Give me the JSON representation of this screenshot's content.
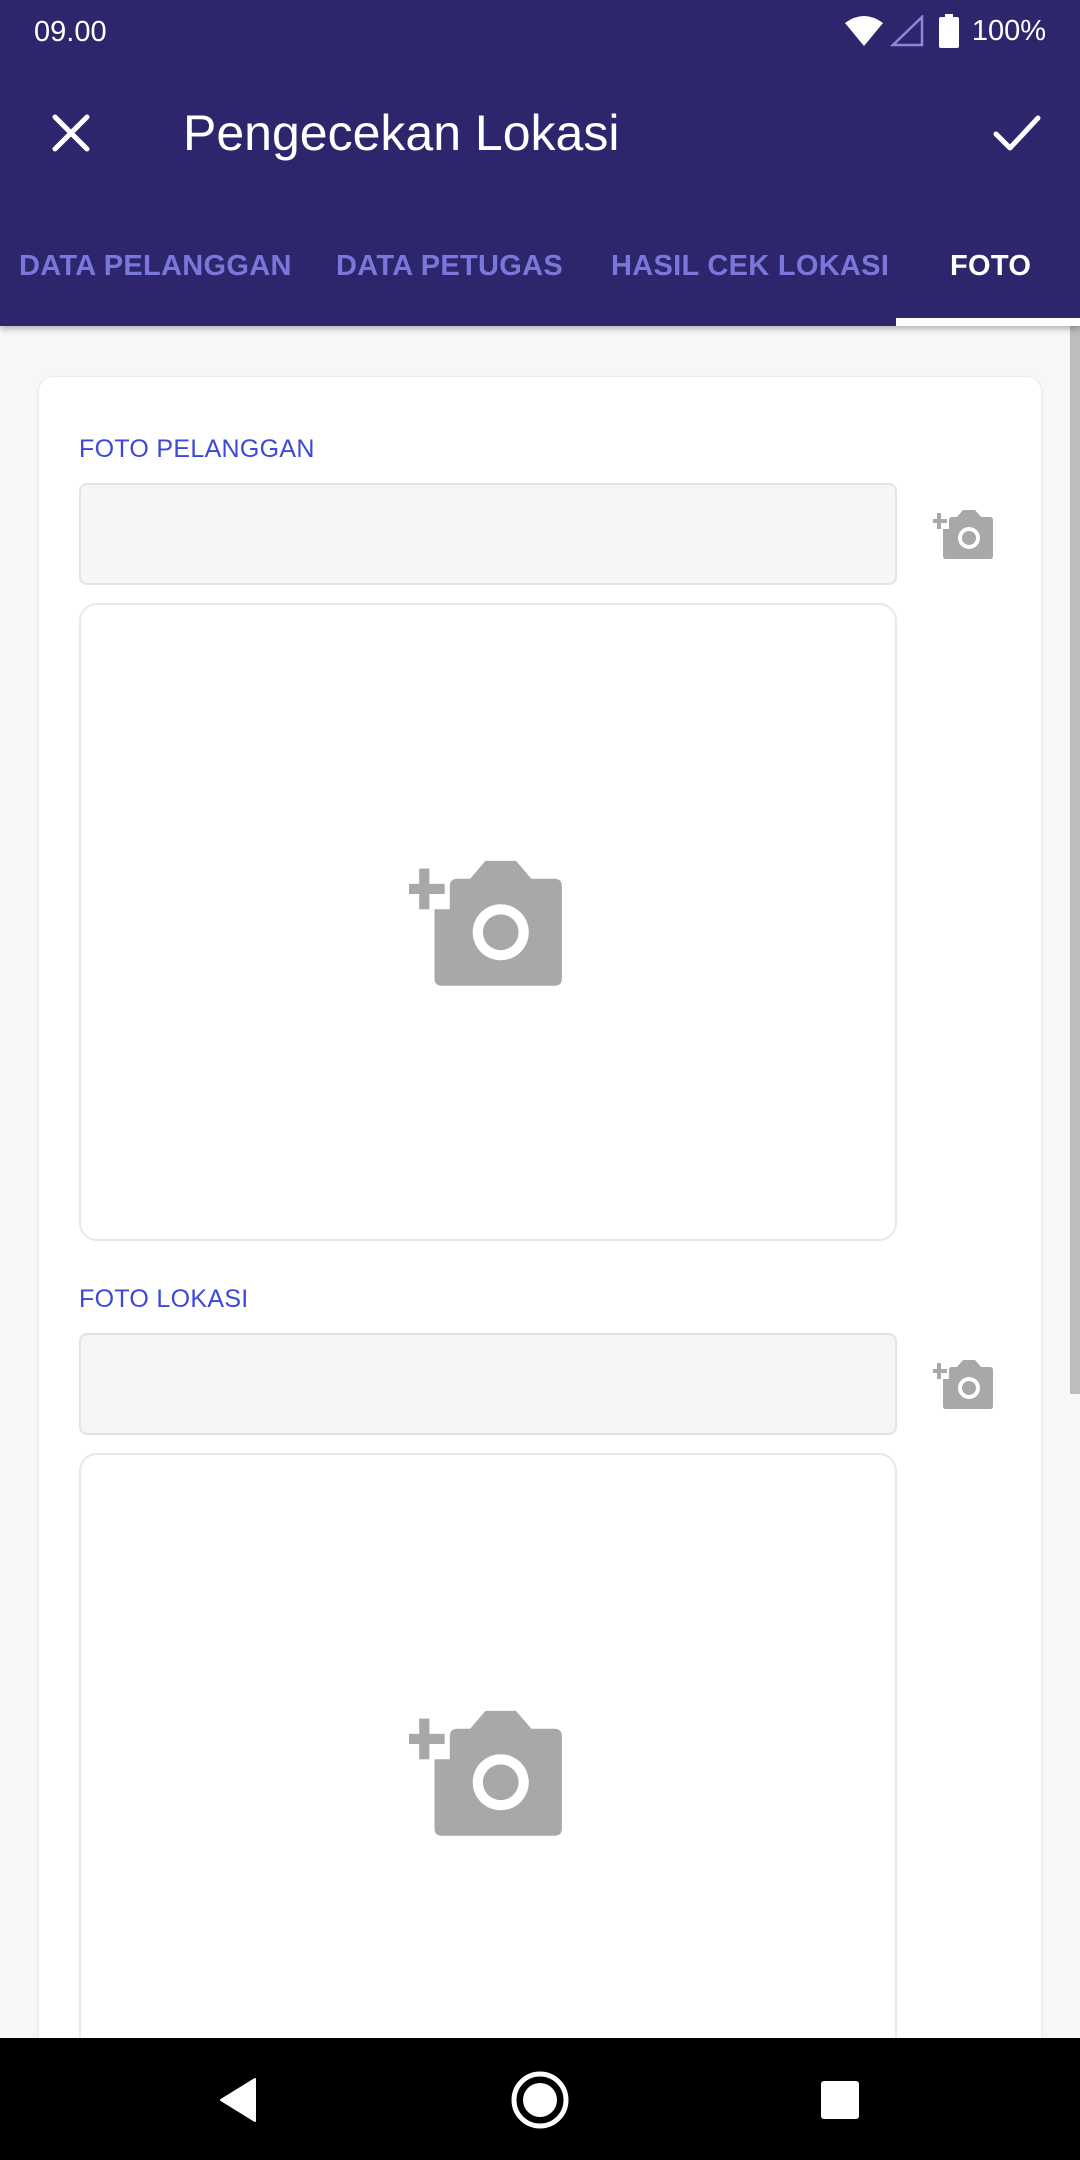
{
  "status_bar": {
    "time": "09.00",
    "battery": "100%"
  },
  "app_bar": {
    "title": "Pengecekan Lokasi"
  },
  "tabs": [
    {
      "label": "DATA PELANGGAN",
      "active": false
    },
    {
      "label": "DATA PETUGAS",
      "active": false
    },
    {
      "label": "HASIL CEK LOKASI",
      "active": false
    },
    {
      "label": "FOTO",
      "active": true
    }
  ],
  "sections": {
    "foto_pelanggan": {
      "label": "FOTO PELANGGAN",
      "value": ""
    },
    "foto_lokasi": {
      "label": "FOTO LOKASI",
      "value": ""
    }
  },
  "icons": {
    "close": "close-icon",
    "confirm": "check-icon",
    "add_photo": "add-photo-icon",
    "nav_back": "back-triangle-icon",
    "nav_home": "home-circle-icon",
    "nav_recents": "recents-square-icon"
  },
  "colors": {
    "app_bar": "#2e266c",
    "tab_inactive": "#7b76d9",
    "tab_active": "#ffffff",
    "section_label": "#3d47d8",
    "icon_gray": "#a8a8a8",
    "background": "#f7f7f7"
  }
}
